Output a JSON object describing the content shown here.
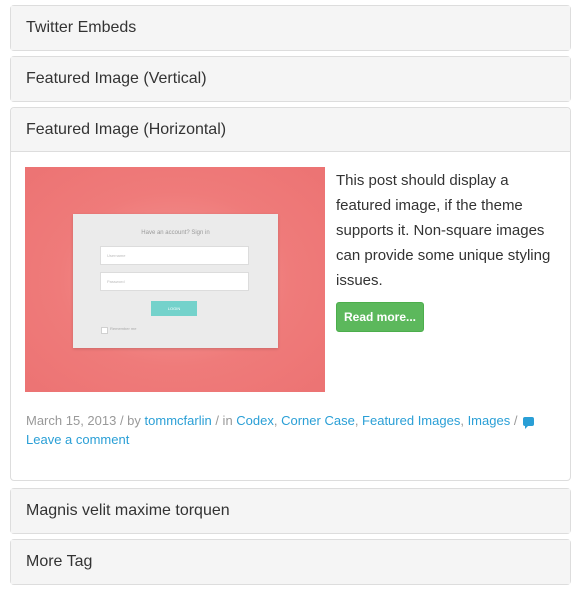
{
  "panels": [
    {
      "title": "Twitter Embeds"
    },
    {
      "title": "Featured Image (Vertical)"
    },
    {
      "title": "Featured Image (Horizontal)"
    },
    {
      "title": "Magnis velit maxime torquen"
    },
    {
      "title": "More Tag"
    }
  ],
  "post": {
    "thumbnail": {
      "title": "Have an account? Sign in",
      "username_placeholder": "Username",
      "password_placeholder": "Password",
      "login_label": "LOGIN",
      "remember_label": "Remember me",
      "background_color": "#ef7b7a",
      "button_color": "#74d2cb"
    },
    "excerpt": "This post should display a featured image, if the theme supports it. Non-square images can provide some unique styling issues.",
    "read_more_label": "Read more...",
    "meta": {
      "date": "March 15, 2013",
      "by_sep": " / by ",
      "author": "tommcfarlin",
      "in_sep": " / in ",
      "categories": [
        "Codex",
        "Corner Case",
        "Featured Images",
        "Images"
      ],
      "comma": ", ",
      "end_sep": " / ",
      "comment_icon": "comment-icon",
      "comment_link": "Leave a comment"
    }
  },
  "colors": {
    "link": "#2a9fd6",
    "button": "#5cb85c",
    "panel_header_bg": "#f5f5f5",
    "meta_text": "#999999"
  }
}
